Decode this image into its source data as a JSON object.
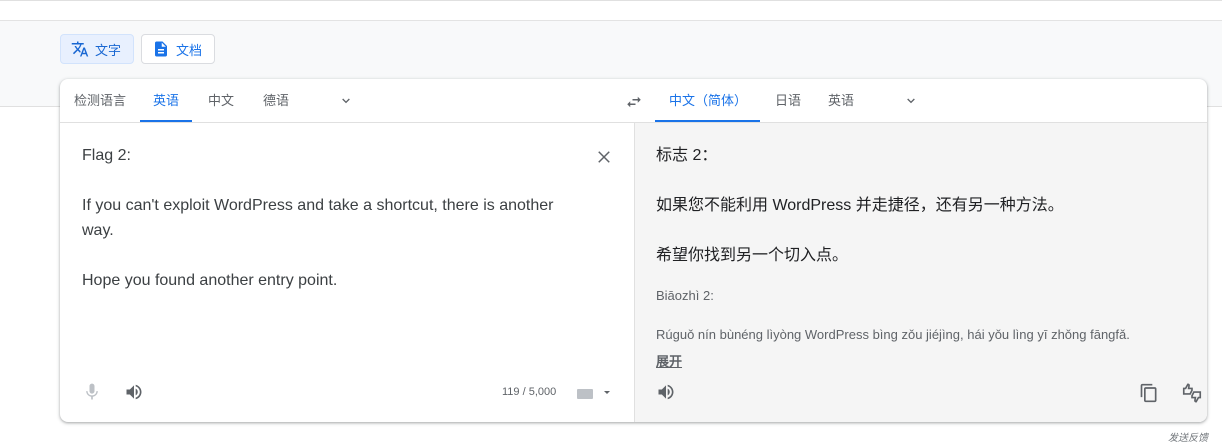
{
  "mode_tabs": [
    {
      "label": "文字",
      "icon": "translate-icon",
      "active": true
    },
    {
      "label": "文档",
      "icon": "document-icon",
      "active": false
    }
  ],
  "source_langs": {
    "detect": "检测语言",
    "items": [
      "英语",
      "中文",
      "德语"
    ],
    "active": "英语"
  },
  "target_langs": {
    "items": [
      "中文（简体）",
      "日语",
      "英语"
    ],
    "active": "中文（简体）"
  },
  "source": {
    "text": "Flag 2:\n\nIf you can't exploit WordPress and take a shortcut, there is another way.\n\nHope you found another entry point.",
    "char_count": "119 / 5,000"
  },
  "target": {
    "text": "标志 2：\n\n如果您不能利用 WordPress 并走捷径，还有另一种方法。\n\n希望你找到另一个切入点。",
    "pinyin_line1": "Biāozhì 2:",
    "pinyin_line2": "Rúguǒ nín bùnéng lìyòng WordPress bìng zǒu jiéjìng, hái yǒu lìng yī zhǒng fāngfǎ.",
    "expand_label": "展开"
  },
  "feedback_label": "发送反馈",
  "colors": {
    "accent": "#1a73e8",
    "target_bg": "#f5f5f5",
    "band_bg": "#f8f9fa"
  }
}
